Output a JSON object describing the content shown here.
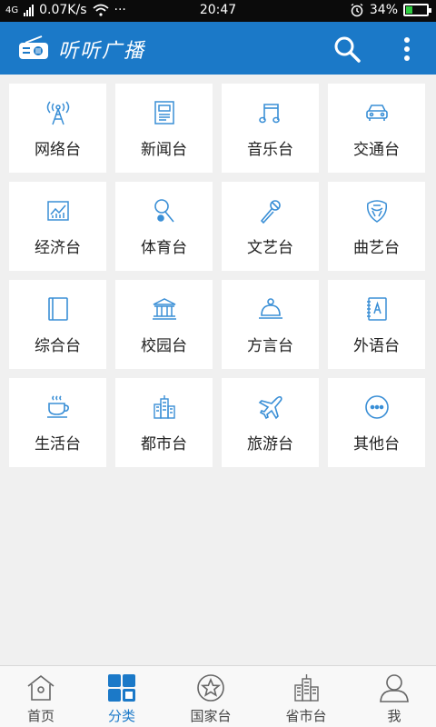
{
  "status_bar": {
    "network": "4G",
    "speed": "0.07K/s",
    "more": "···",
    "time": "20:47",
    "battery_text": "34%",
    "battery_level": 0.34
  },
  "app_bar": {
    "title": "听听广播",
    "logo_icon": "radio-icon",
    "search_icon": "search-icon",
    "more_icon": "more-vertical-icon"
  },
  "categories": [
    {
      "label": "网络台",
      "icon": "antenna-tower-icon"
    },
    {
      "label": "新闻台",
      "icon": "newspaper-icon"
    },
    {
      "label": "音乐台",
      "icon": "music-note-icon"
    },
    {
      "label": "交通台",
      "icon": "car-icon"
    },
    {
      "label": "经济台",
      "icon": "chart-icon"
    },
    {
      "label": "体育台",
      "icon": "racket-ball-icon"
    },
    {
      "label": "文艺台",
      "icon": "microphone-icon"
    },
    {
      "label": "曲艺台",
      "icon": "opera-mask-icon"
    },
    {
      "label": "综合台",
      "icon": "book-icon"
    },
    {
      "label": "校园台",
      "icon": "school-building-icon"
    },
    {
      "label": "方言台",
      "icon": "reception-bell-icon"
    },
    {
      "label": "外语台",
      "icon": "dictionary-icon"
    },
    {
      "label": "生活台",
      "icon": "coffee-cup-icon"
    },
    {
      "label": "都市台",
      "icon": "city-buildings-icon"
    },
    {
      "label": "旅游台",
      "icon": "airplane-icon"
    },
    {
      "label": "其他台",
      "icon": "more-horizontal-icon"
    }
  ],
  "bottom_nav": {
    "items": [
      {
        "label": "首页",
        "icon": "home-icon",
        "active": false
      },
      {
        "label": "分类",
        "icon": "grid-icon",
        "active": true
      },
      {
        "label": "国家台",
        "icon": "star-icon",
        "active": false
      },
      {
        "label": "省市台",
        "icon": "buildings-icon",
        "active": false
      },
      {
        "label": "我",
        "icon": "user-icon",
        "active": false
      }
    ]
  },
  "colors": {
    "primary": "#1b79c8",
    "icon_blue": "#3a8fd6",
    "background": "#f0f0f0",
    "tile": "#ffffff",
    "battery": "#2ecc40"
  }
}
